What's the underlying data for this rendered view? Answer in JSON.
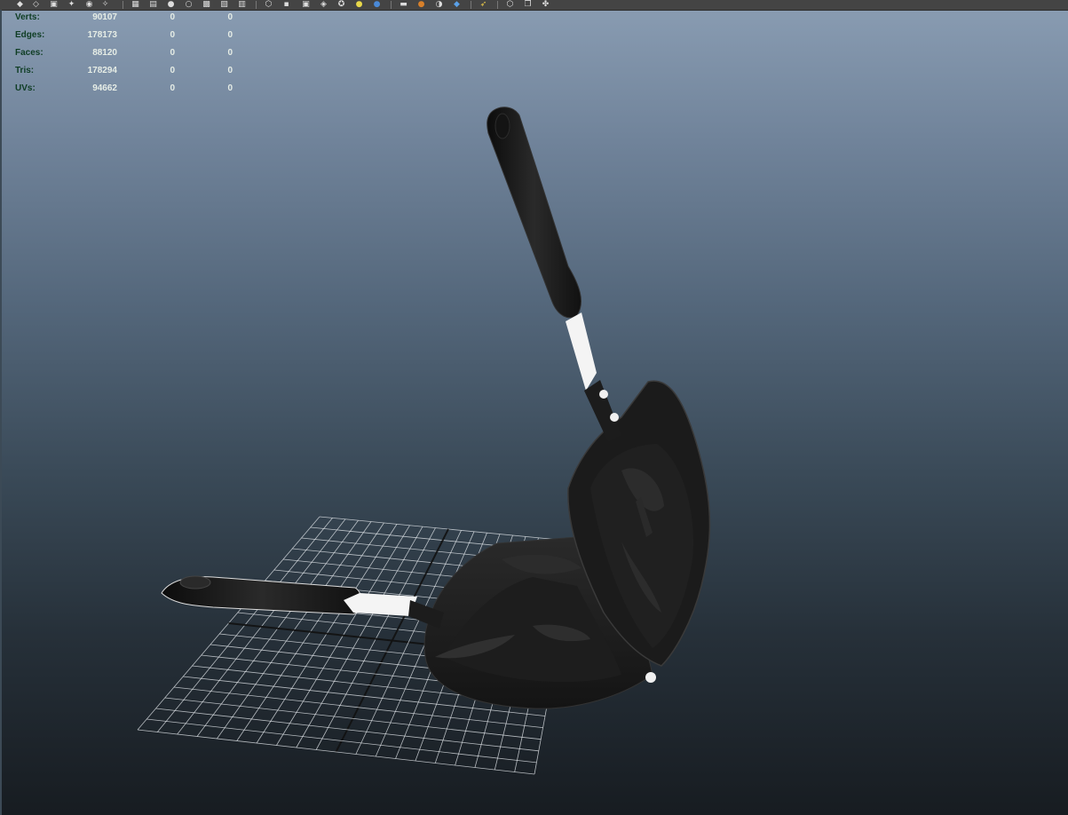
{
  "toolbar": {
    "icons": [
      "smooth-shade-icon",
      "wireframe-icon",
      "texture-icon",
      "lighting-icon",
      "camera-icon",
      "snap-icon",
      "grid-icon",
      "isolate-icon",
      "xray-icon",
      "ambient-occlusion-icon",
      "motion-blur-icon",
      "multisample-icon",
      "depth-of-field-icon",
      "resolution-gate-icon",
      "film-gate-icon",
      "safe-action-icon",
      "select-object-icon",
      "select-component-icon"
    ]
  },
  "hud": {
    "rows": [
      {
        "label": "Verts:",
        "v1": "90107",
        "v2": "0",
        "v3": "0"
      },
      {
        "label": "Edges:",
        "v1": "178173",
        "v2": "0",
        "v3": "0"
      },
      {
        "label": "Faces:",
        "v1": "88120",
        "v2": "0",
        "v3": "0"
      },
      {
        "label": "Tris:",
        "v1": "178294",
        "v2": "0",
        "v3": "0"
      },
      {
        "label": "UVs:",
        "v1": "94662",
        "v2": "0",
        "v3": "0"
      }
    ]
  },
  "colors": {
    "hud_label": "#0f3d24",
    "hud_value": "#e6ede6",
    "grid_line": "#e8ecf0",
    "grid_axis": "#111111",
    "model_body": "#1a1a1a"
  }
}
